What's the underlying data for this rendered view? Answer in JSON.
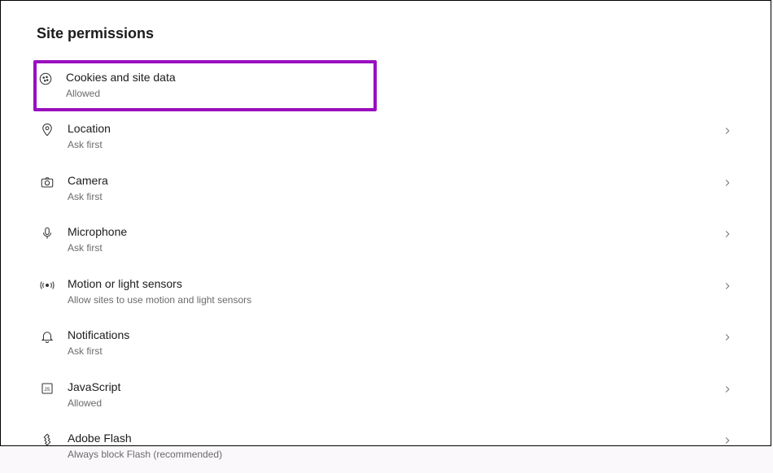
{
  "header": {
    "title": "Site permissions"
  },
  "permissions": [
    {
      "icon": "cookie-icon",
      "title": "Cookies and site data",
      "sub": "Allowed",
      "highlighted": true
    },
    {
      "icon": "location-icon",
      "title": "Location",
      "sub": "Ask first"
    },
    {
      "icon": "camera-icon",
      "title": "Camera",
      "sub": "Ask first"
    },
    {
      "icon": "microphone-icon",
      "title": "Microphone",
      "sub": "Ask first"
    },
    {
      "icon": "motion-icon",
      "title": "Motion or light sensors",
      "sub": "Allow sites to use motion and light sensors"
    },
    {
      "icon": "bell-icon",
      "title": "Notifications",
      "sub": "Ask first"
    },
    {
      "icon": "javascript-icon",
      "title": "JavaScript",
      "sub": "Allowed"
    },
    {
      "icon": "flash-icon",
      "title": "Adobe Flash",
      "sub": "Always block Flash (recommended)"
    }
  ],
  "highlight_color": "#9a0fbf"
}
